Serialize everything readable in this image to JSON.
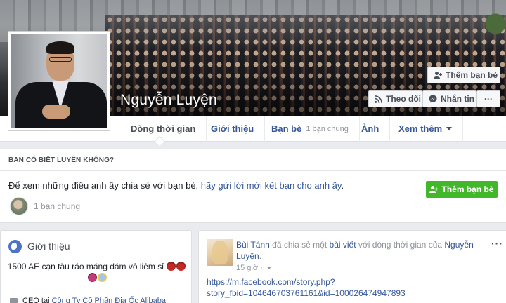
{
  "profile": {
    "name": "Nguyễn Luyện"
  },
  "cover_buttons": {
    "add_friend": "Thêm bạn bè",
    "follow": "Theo dõi",
    "message": "Nhắn tin",
    "more": "···"
  },
  "nav": {
    "timeline": "Dòng thời gian",
    "about": "Giới thiệu",
    "friends": "Bạn bè",
    "friends_sub": "1 bạn chung",
    "photos": "Ảnh",
    "more": "Xem thêm"
  },
  "pymk": {
    "heading": "BẠN CÓ BIẾT LUYỆN KHÔNG?",
    "text_prefix": "Để xem những điều anh ấy chia sẻ với bạn bè, ",
    "text_link": "hãy gửi lời mời kết bạn cho anh ấy",
    "text_suffix": ".",
    "add_button": "Thêm bạn bè",
    "mutual": "1 bạn chung"
  },
  "intro": {
    "title": "Giới thiệu",
    "bio": "1500 AE cạn tàu ráo máng đám vô liêm sỉ",
    "work_prefix": "CEO tại ",
    "work_link": "Công Ty Cổ Phần Địa Ốc Alibaba"
  },
  "post": {
    "author": "Bùi Tánh",
    "action": " đã chia sẻ một ",
    "object": "bài viết",
    "action2": " với dòng thời gian của ",
    "target": "Nguyễn Luyện",
    "end": ".",
    "time": "15 giờ",
    "time_sep": " · ",
    "menu": "···",
    "url_line1": "https://m.facebook.com/story.php?",
    "url_line2": "story_fbid=104646703761161&id=100026474947893"
  },
  "colors": {
    "link": "#365899",
    "green": "#42b72a",
    "page_bg": "#e9ebee"
  },
  "icons": [
    "add-friend-icon",
    "rss-icon",
    "messenger-icon",
    "globe-icon",
    "briefcase-icon",
    "privacy-caret-icon"
  ]
}
